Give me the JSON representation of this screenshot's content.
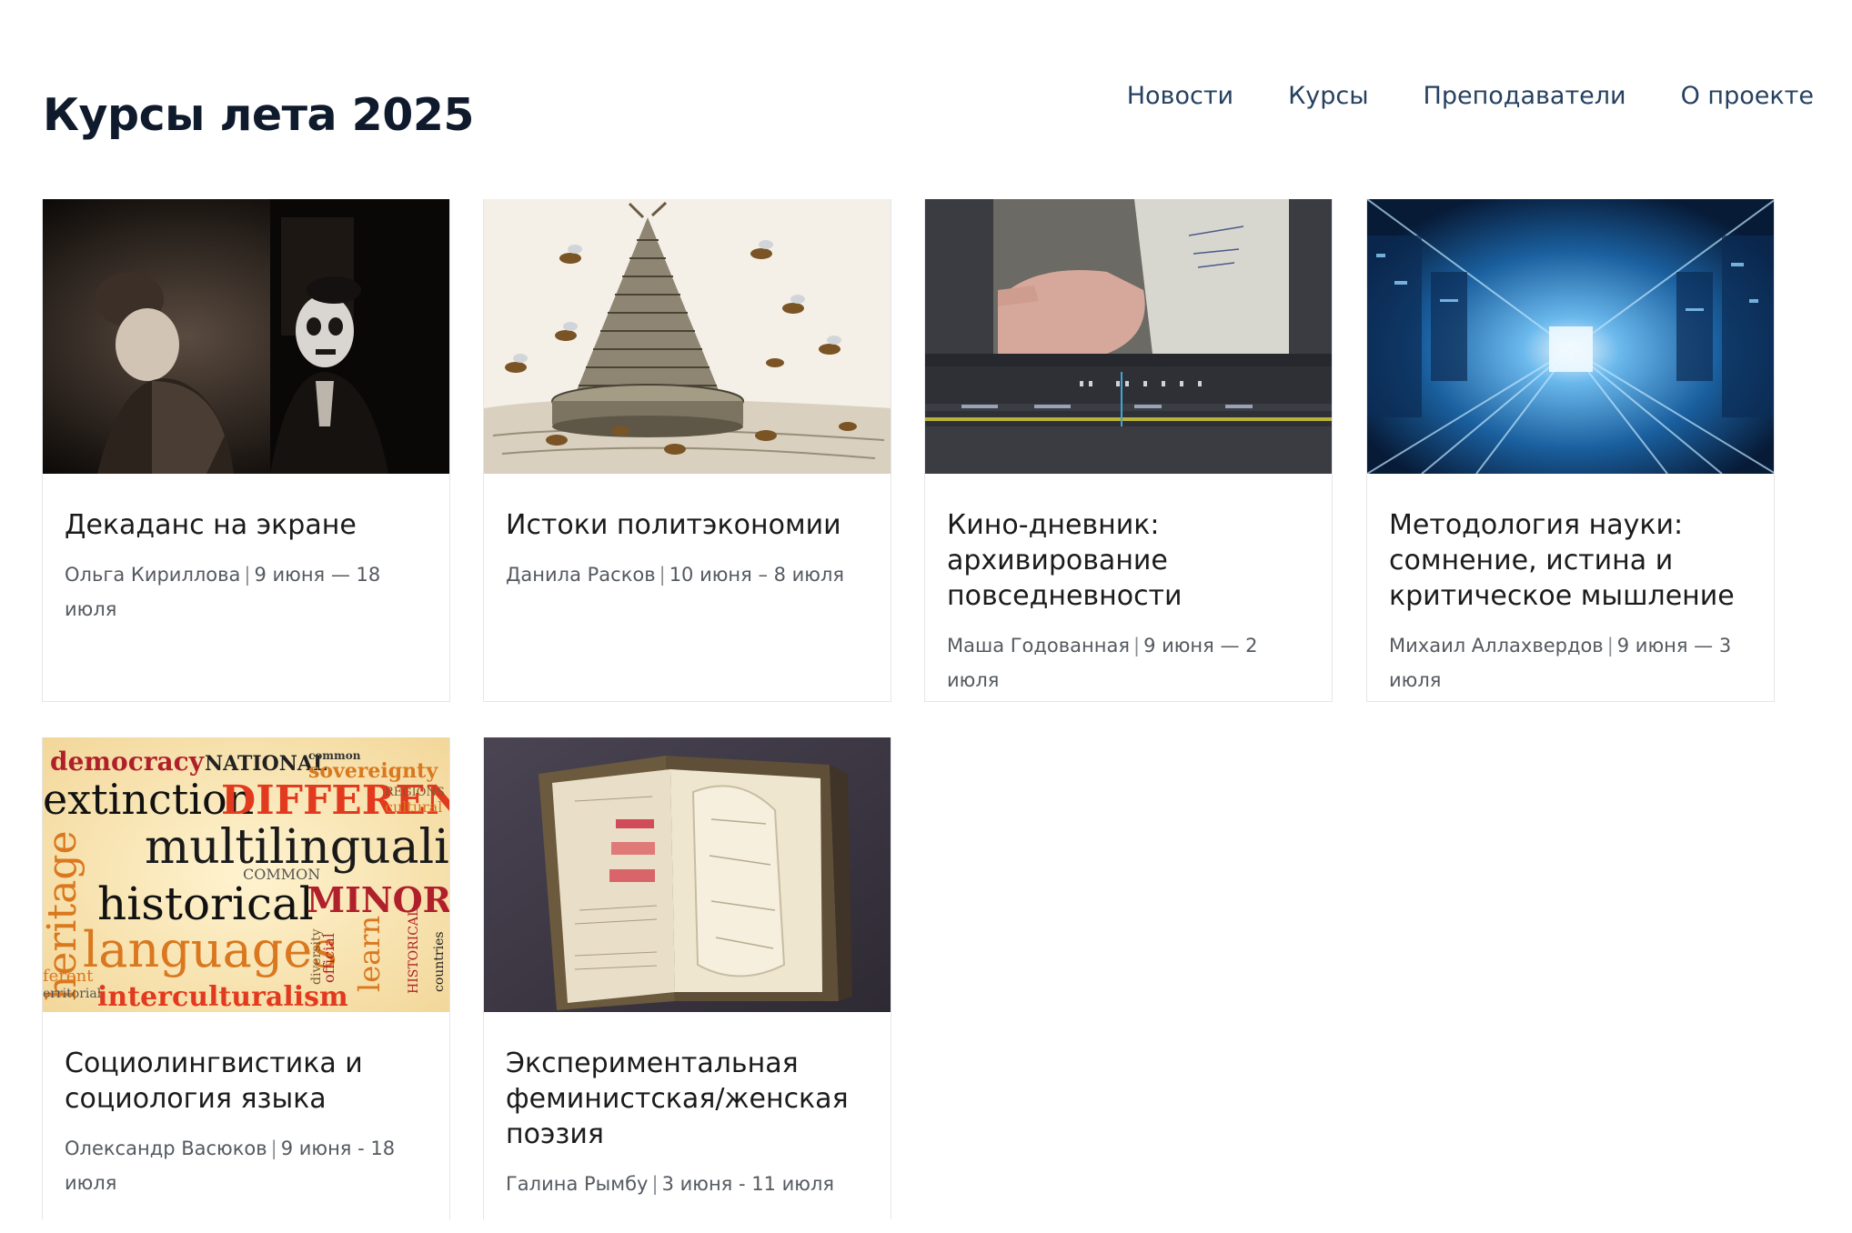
{
  "header": {
    "title": "Курсы лета 2025"
  },
  "nav": {
    "items": [
      {
        "label": "Новости"
      },
      {
        "label": "Курсы"
      },
      {
        "label": "Преподаватели"
      },
      {
        "label": "О проекте"
      }
    ]
  },
  "courses": [
    {
      "title": "Декаданс на экране",
      "author": "Ольга Кириллова",
      "dates": "9 июня — 18 июля",
      "image_icon": "film-still-image"
    },
    {
      "title": "Истоки политэкономии",
      "author": "Данила Расков",
      "dates": "10 июня – 8 июля",
      "image_icon": "beehive-engraving-image"
    },
    {
      "title": "Кино-дневник: архивирование повседневности",
      "author": "Маша Годованная",
      "dates": "9 июня — 2 июля",
      "image_icon": "video-editor-image"
    },
    {
      "title": "Методология науки: сомнение, истина и критическое мышление",
      "author": "Михаил Аллахвердов",
      "dates": "9 июня — 3 июля",
      "image_icon": "digital-corridor-image"
    },
    {
      "title": "Социолингвистика и социология языка",
      "author": "Олександр Васюков",
      "dates": "9 июня - 18 июля",
      "image_icon": "word-cloud-image",
      "word_cloud": {
        "w1": "democracy",
        "w2": "NATIONAL",
        "w3": "common",
        "w4": "sovereignty",
        "w5": "extinction",
        "w6": "DIFFERENT",
        "w7": "REGIONS",
        "w8": "cultural",
        "w9": "heritage",
        "w10": "multilingualism",
        "w11": "COMMON",
        "w12": "historical",
        "w13": "MINORITY",
        "w14": "languages",
        "w15": "learn",
        "w16": "interculturalism",
        "w17": "official",
        "w18": "diversity",
        "w19": "countries",
        "w20": "HISTORICAL",
        "w21": "ferent",
        "w22": "erritorial"
      }
    },
    {
      "title": "Экспериментальная феминистская/женская поэзия",
      "author": "Галина Рымбу",
      "dates": "3 июня - 11 июля",
      "image_icon": "old-book-image"
    }
  ],
  "colors": {
    "title": "#0f1b2d",
    "nav_link": "#26415f",
    "card_border": "#e4e6ea",
    "meta_text": "#555a60"
  }
}
